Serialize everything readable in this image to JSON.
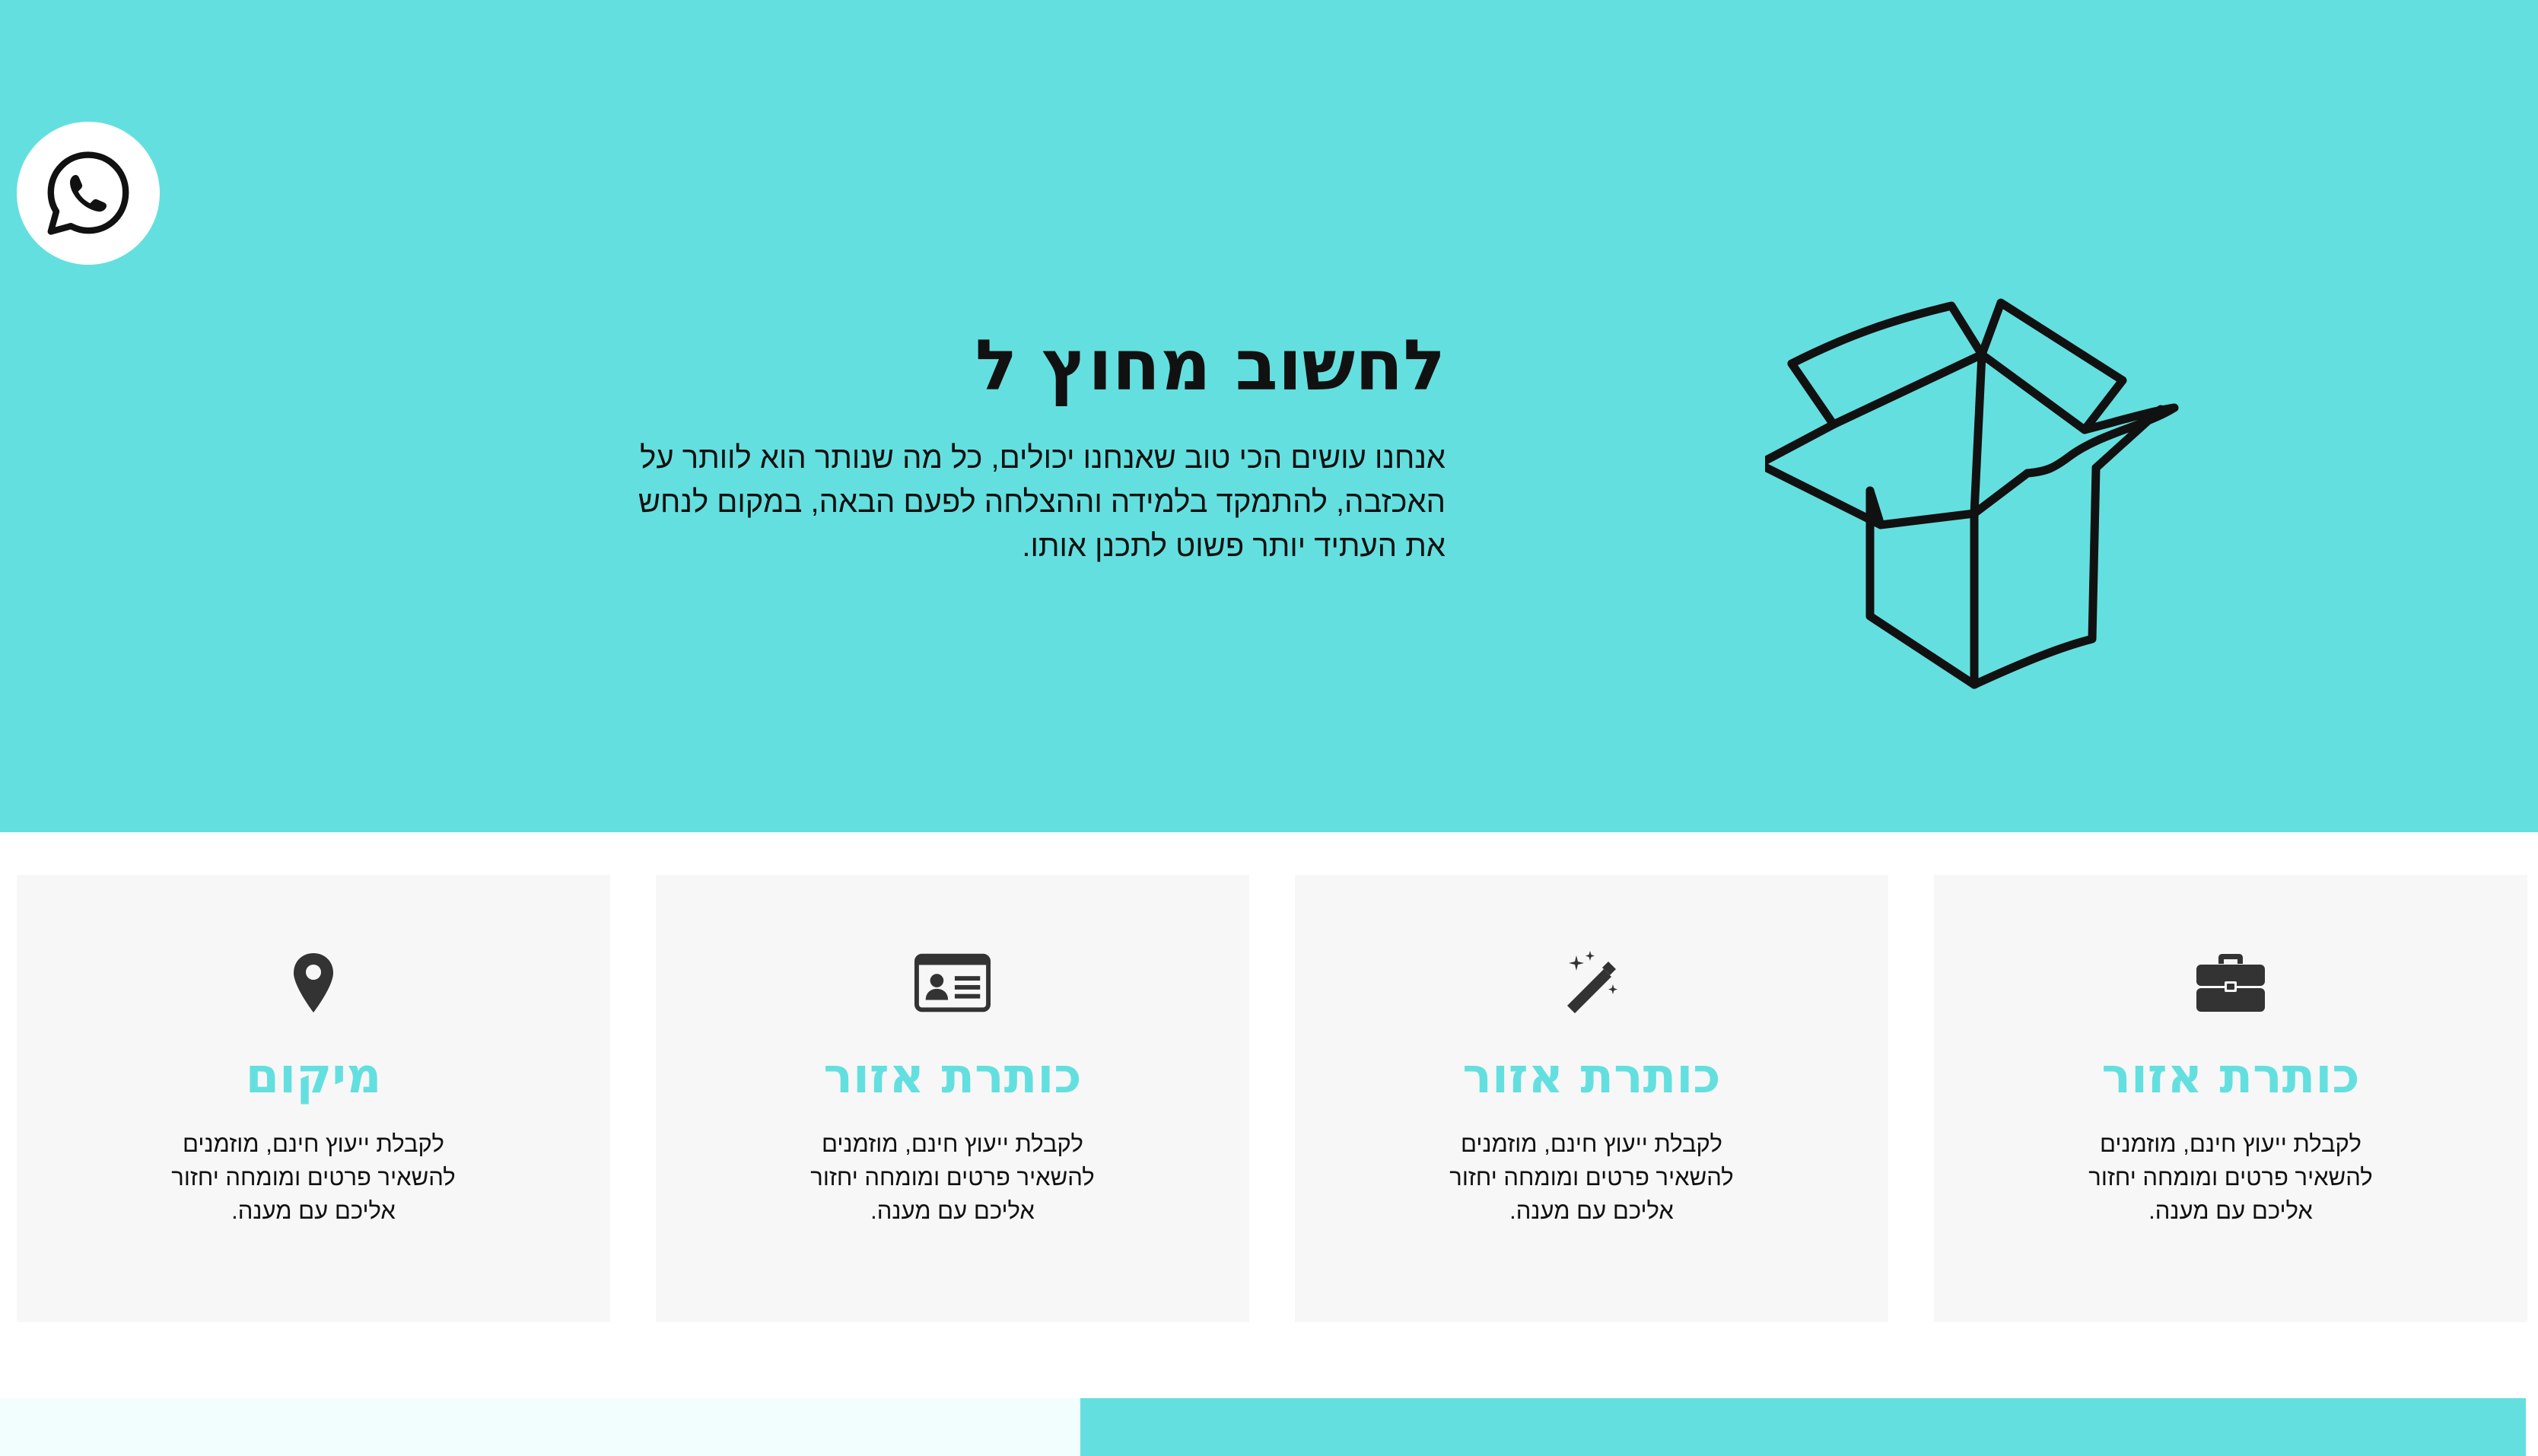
{
  "colors": {
    "accent": "#64dfdf",
    "card_bg": "#f7f7f7",
    "text": "#111111",
    "bottom_left": "#f2fefe"
  },
  "whatsapp": {
    "icon": "whatsapp-icon"
  },
  "hero": {
    "title": "לחשוב מחוץ ל",
    "description": "אנחנו עושים הכי טוב שאנחנו יכולים, כל מה שנותר הוא לוותר על האכזבה, להתמקד בלמידה וההצלחה לפעם הבאה, במקום לנחש את העתיד יותר פשוט לתכנן אותו.",
    "illustration": "open-box-illustration"
  },
  "cards": [
    {
      "icon": "location-pin-icon",
      "title": "מיקום",
      "text": "לקבלת ייעוץ חינם, מוזמנים להשאיר פרטים ומומחה יחזור אליכם עם מענה."
    },
    {
      "icon": "id-card-icon",
      "title": "כותרת אזור",
      "text": "לקבלת ייעוץ חינם, מוזמנים להשאיר פרטים ומומחה יחזור אליכם עם מענה."
    },
    {
      "icon": "magic-wand-icon",
      "title": "כותרת אזור",
      "text": "לקבלת ייעוץ חינם, מוזמנים להשאיר פרטים ומומחה יחזור אליכם עם מענה."
    },
    {
      "icon": "briefcase-icon",
      "title": "כותרת אזור",
      "text": "לקבלת ייעוץ חינם, מוזמנים להשאיר פרטים ומומחה יחזור אליכם עם מענה."
    }
  ]
}
